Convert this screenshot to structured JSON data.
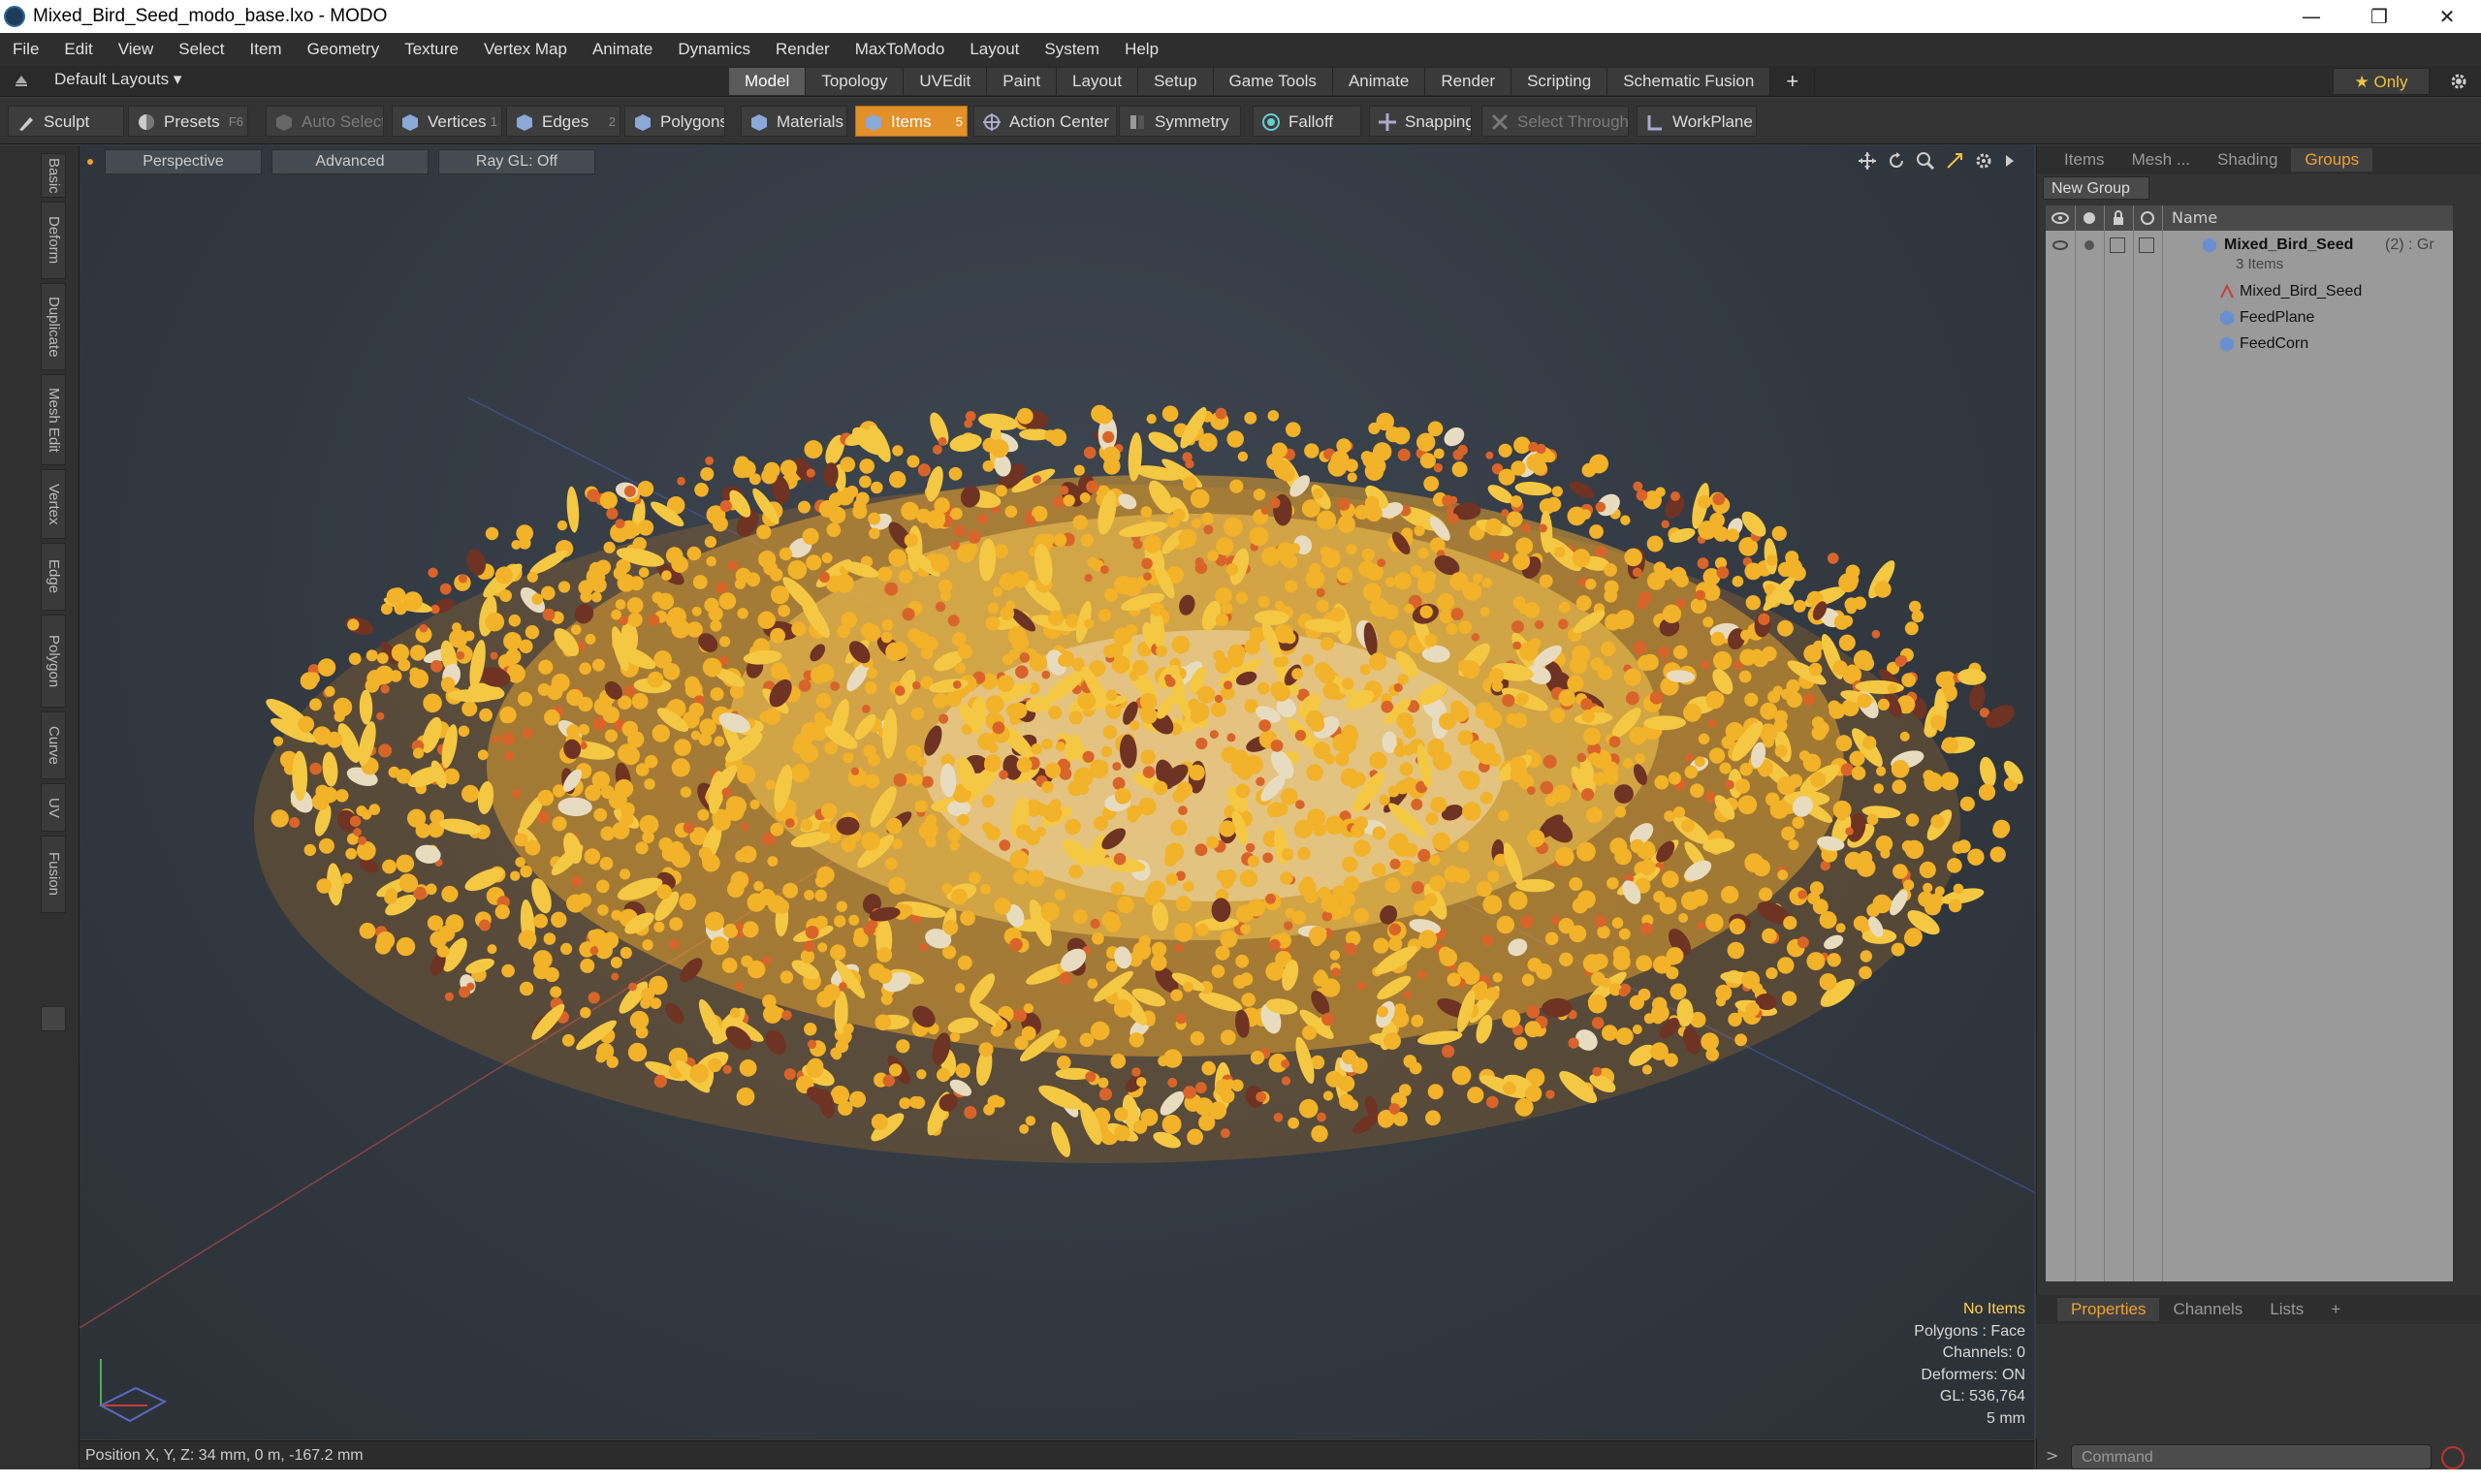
{
  "window": {
    "title": "Mixed_Bird_Seed_modo_base.lxo - MODO",
    "minimize_glyph": "—",
    "restore_glyph": "❐",
    "close_glyph": "✕"
  },
  "menu": [
    "File",
    "Edit",
    "View",
    "Select",
    "Item",
    "Geometry",
    "Texture",
    "Vertex Map",
    "Animate",
    "Dynamics",
    "Render",
    "MaxToModo",
    "Layout",
    "System",
    "Help"
  ],
  "layoutbar": {
    "layouts_label": "Default Layouts ▾",
    "tabs": [
      "Model",
      "Topology",
      "UVEdit",
      "Paint",
      "Layout",
      "Setup",
      "Game Tools",
      "Animate",
      "Render",
      "Scripting",
      "Schematic Fusion"
    ],
    "active_tab": "Model",
    "add_glyph": "+",
    "only_label": "★  Only"
  },
  "toolbar": {
    "sculpt": "Sculpt",
    "presets": "Presets",
    "presets_key": "F6",
    "auto_select": "Auto Select",
    "vertices": "Vertices",
    "vertices_key": "1",
    "edges": "Edges",
    "edges_key": "2",
    "polygons": "Polygons",
    "materials": "Materials",
    "items": "Items",
    "items_key": "5",
    "action_center": "Action Center",
    "symmetry": "Symmetry",
    "falloff": "Falloff",
    "snapping": "Snapping",
    "select_through": "Select Through",
    "workplane": "WorkPlane"
  },
  "left_tabs": [
    "Basic",
    "Deform",
    "Duplicate",
    "Mesh Edit",
    "Vertex",
    "Edge",
    "Polygon",
    "Curve",
    "UV",
    "Fusion"
  ],
  "viewport": {
    "perspective": "Perspective",
    "advanced": "Advanced",
    "raygl": "Ray GL: Off",
    "stats": {
      "no_items": "No Items",
      "polygons": "Polygons : Face",
      "channels": "Channels: 0",
      "deformers": "Deformers: ON",
      "gl": "GL: 536,764",
      "scale": "5 mm"
    }
  },
  "position_bar": "Position X, Y, Z:   34 mm, 0 m, -167.2 mm",
  "right_panel": {
    "top_tabs": [
      "Items",
      "Mesh ...",
      "Shading",
      "Groups"
    ],
    "active_top_tab": "Groups",
    "new_group": "New Group",
    "name_header": "Name",
    "tree": {
      "group_name": "Mixed_Bird_Seed",
      "group_suffix": "(2) : Gr",
      "group_count": "3 Items",
      "children": [
        "Mixed_Bird_Seed",
        "FeedPlane",
        "FeedCorn"
      ]
    },
    "bottom_tabs": [
      "Properties",
      "Channels",
      "Lists"
    ],
    "active_bottom_tab": "Properties",
    "add_glyph": "+",
    "command_placeholder": "Command"
  },
  "colors": {
    "accent": "#e2902a",
    "viewport_bg": "#333a42",
    "seed_yellow": "#f2b229",
    "seed_orange": "#d9642a",
    "seed_brown": "#6e3322",
    "seed_cream": "#e8dcc0"
  }
}
